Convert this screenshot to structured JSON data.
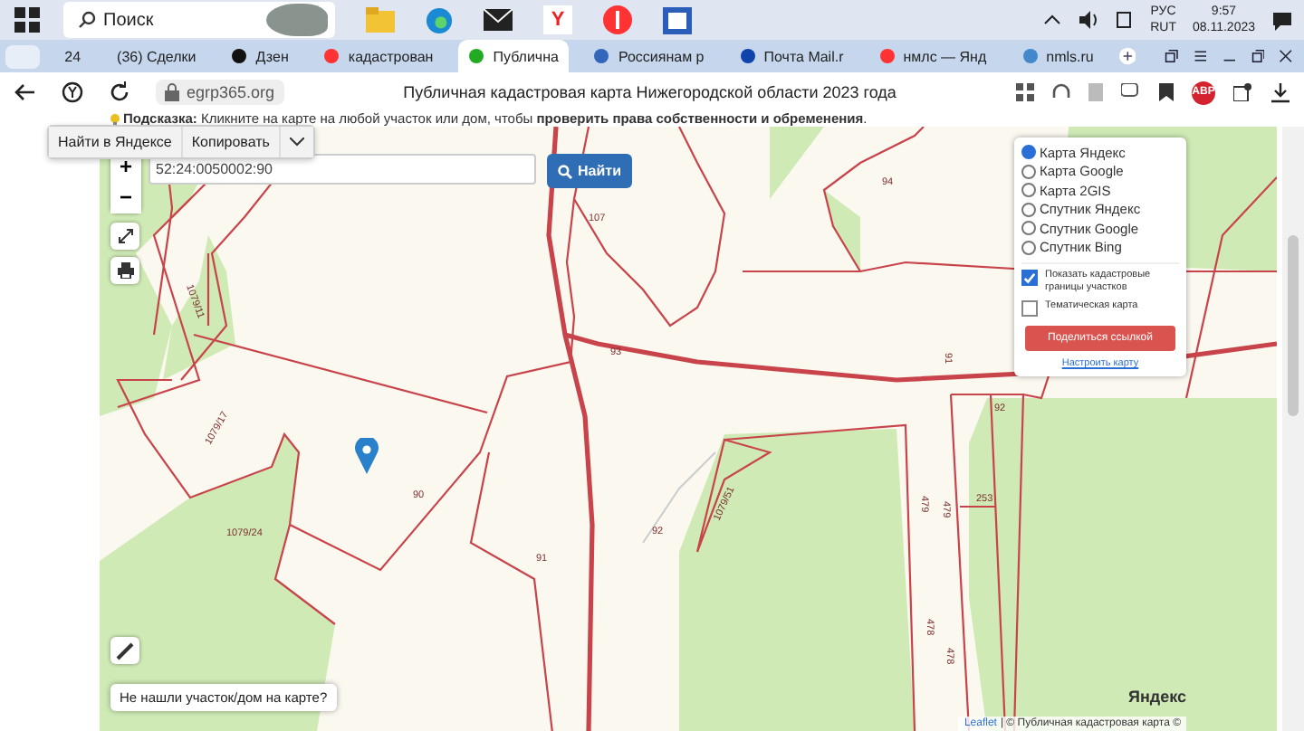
{
  "taskbar": {
    "search_placeholder": "Поиск",
    "browser_logo": "Y",
    "language": [
      "РУС",
      "RUT"
    ],
    "time": "9:57",
    "date": "08.11.2023"
  },
  "tabs": [
    {
      "label": "24",
      "selected": false,
      "kind": "counter"
    },
    {
      "label": "(36) Сделки",
      "selected": false,
      "kind": "plain"
    },
    {
      "label": "Дзен",
      "selected": false,
      "kind": "dzen"
    },
    {
      "label": "кадастрован",
      "selected": false,
      "kind": "yandex"
    },
    {
      "label": "Публична",
      "selected": true,
      "kind": "check"
    },
    {
      "label": "Россиянам р",
      "selected": false,
      "kind": "gov"
    },
    {
      "label": "Почта Mail.r",
      "selected": false,
      "kind": "mail"
    },
    {
      "label": "нмлс — Янд",
      "selected": false,
      "kind": "yandex"
    },
    {
      "label": "nmls.ru",
      "selected": false,
      "kind": "site"
    }
  ],
  "address_bar": {
    "domain": "egrp365.org",
    "page_title": "Публичная кадастровая карта Нижегородской области 2023 года",
    "adblock_badge": "ABP"
  },
  "hint": "**Подсказка:** Кликните на карте на любой участок или дом, чтобы **проверить права собственности и обременения**.",
  "context_popup": {
    "buttons": [
      "Найти в Яндексе",
      "Копировать"
    ]
  },
  "search": {
    "value": "52:24:0050002:90",
    "button": "Найти"
  },
  "zoom_buttons": [
    "+",
    "−"
  ],
  "layers": [
    {
      "label": "Карта Яндекс",
      "selected": true
    },
    {
      "label": "Карта Google",
      "selected": false
    },
    {
      "label": "Карта 2GIS",
      "selected": false
    },
    {
      "label": "Спутник Яндекс",
      "selected": false
    },
    {
      "label": "Спутник Google",
      "selected": false
    },
    {
      "label": "Спутник Bing",
      "selected": false
    }
  ],
  "options": [
    {
      "label": "Показать кадастровые границы участков",
      "checked": true
    },
    {
      "label": "Тематическая карта",
      "checked": false
    }
  ],
  "share_button": "Поделиться ссылкой",
  "settings_link": "Настроить карту",
  "parcels": [
    "107",
    "94",
    "93",
    "91",
    "92",
    "90",
    "91",
    "92",
    "1079/11",
    "1079/17",
    "1079/24",
    "1079/51",
    "479",
    "479",
    "253",
    "478",
    "478"
  ],
  "missing_prompt": "Не нашли участок/дом на карте?",
  "map_logo": "Яндекс",
  "attribution": [
    {
      "text": "Leaflet",
      "kind": "link"
    },
    {
      "text": "| © Публичная кадастровая карта ©",
      "kind": "text"
    }
  ]
}
